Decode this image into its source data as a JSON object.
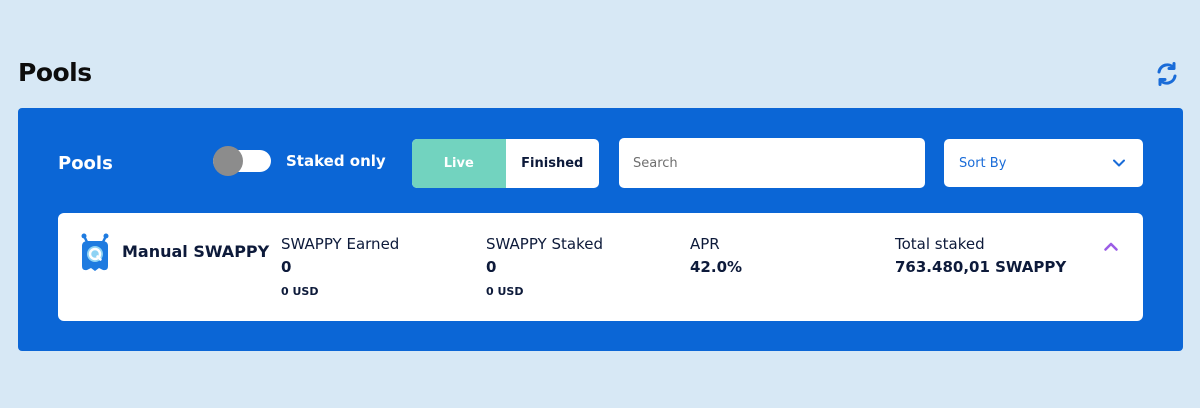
{
  "page": {
    "title": "Pools",
    "refresh_icon": "refresh-icon"
  },
  "panel": {
    "title": "Pools",
    "staked_only": {
      "label": "Staked only",
      "enabled": false
    },
    "tabs": [
      {
        "label": "Live",
        "active": true
      },
      {
        "label": "Finished",
        "active": false
      }
    ],
    "search": {
      "placeholder": "Search",
      "value": ""
    },
    "sort": {
      "label": "Sort By",
      "icon": "chevron-down-icon"
    }
  },
  "pool": {
    "name": "Manual SWAPPY",
    "logo_icon": "swappy-logo-icon",
    "earned": {
      "label": "SWAPPY Earned",
      "value": "0",
      "usd": "0 USD"
    },
    "staked": {
      "label": "SWAPPY Staked",
      "value": "0",
      "usd": "0 USD"
    },
    "apr": {
      "label": "APR",
      "value": "42.0%"
    },
    "total": {
      "label": "Total staked",
      "value": "763.480,01 SWAPPY"
    },
    "collapse_icon": "chevron-up-icon"
  },
  "colors": {
    "background": "#d7e8f5",
    "panel": "#0b66d6",
    "active_tab": "#72d3bf",
    "accent_purple": "#9b5de5",
    "link_blue": "#1a6cd8"
  }
}
